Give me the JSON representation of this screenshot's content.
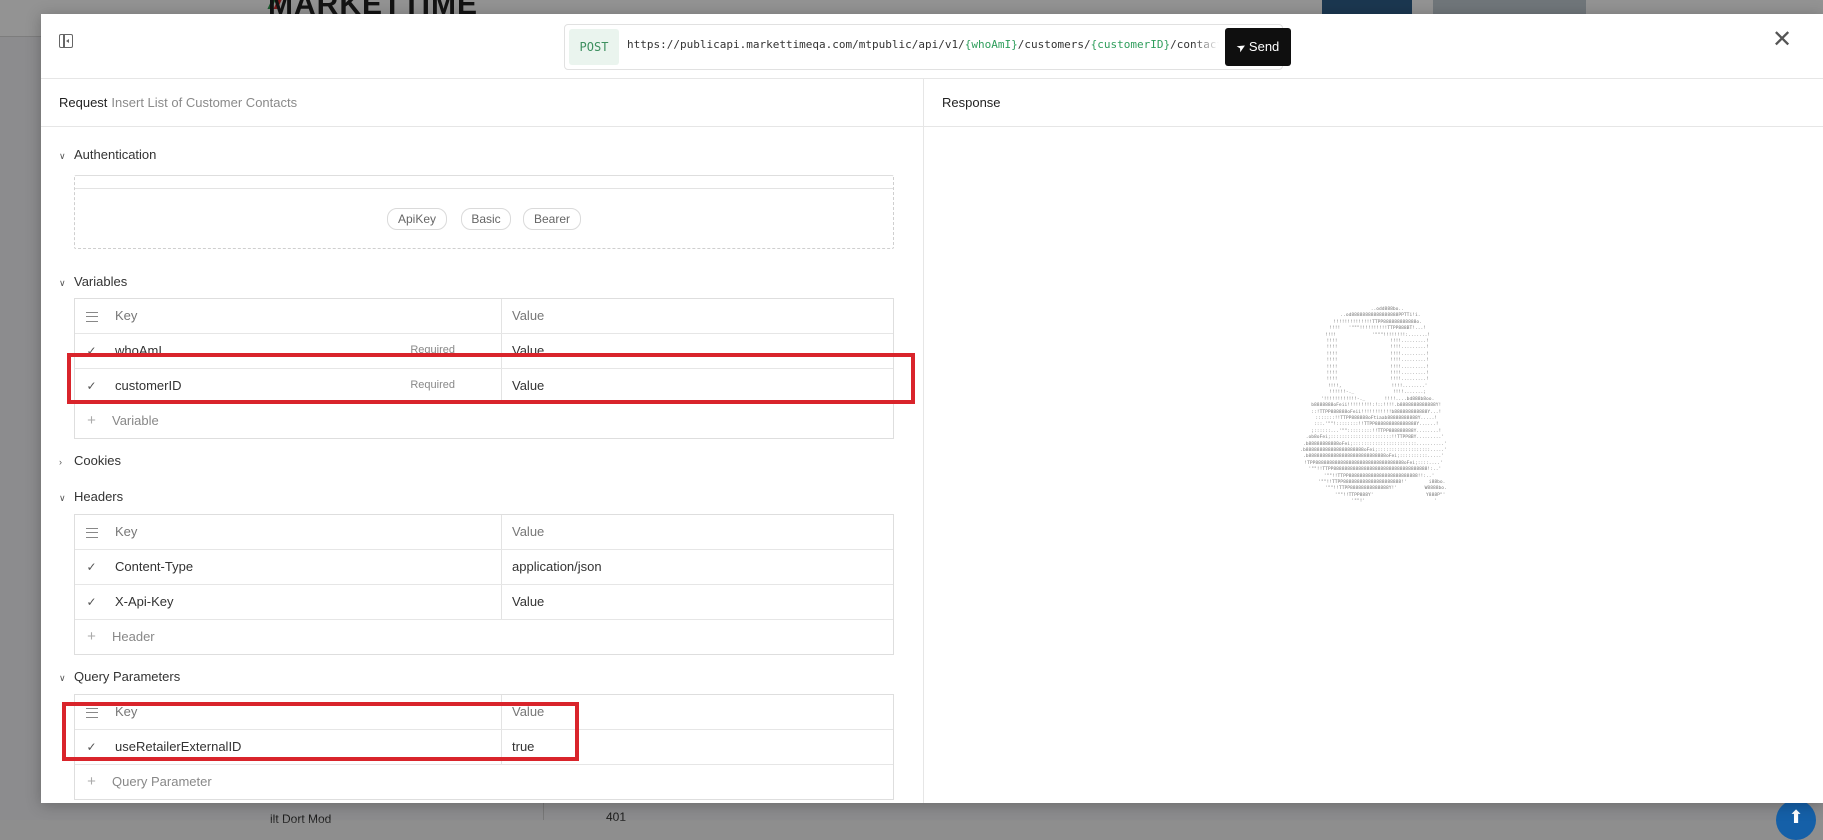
{
  "background": {
    "logo_text": "MARKETTIME",
    "bottom_text": "ilt Dort Mod",
    "bottom_number": "401",
    "scroll_top_icon": "arrow-up-icon"
  },
  "modal": {
    "url_bar": {
      "method": "POST",
      "url_prefix": "https://publicapi.markettimeqa.com/mtpublic/api/v1/",
      "var1": "{whoAmI}",
      "mid": "/customers/",
      "var2": "{customerID}",
      "suffix": "/contacts",
      "send_label": "Send"
    },
    "request": {
      "title": "Request",
      "subtitle": "Insert List of Customer Contacts",
      "authentication": {
        "label": "Authentication",
        "options": [
          "ApiKey",
          "Basic",
          "Bearer"
        ]
      },
      "variables": {
        "label": "Variables",
        "header_key": "Key",
        "header_value": "Value",
        "rows": [
          {
            "key": "whoAmI",
            "required": "Required",
            "value": "Value"
          },
          {
            "key": "customerID",
            "required": "Required",
            "value": "Value"
          }
        ],
        "add_label": "Variable"
      },
      "cookies": {
        "label": "Cookies"
      },
      "headers": {
        "label": "Headers",
        "header_key": "Key",
        "header_value": "Value",
        "rows": [
          {
            "key": "Content-Type",
            "value": "application/json"
          },
          {
            "key": "X-Api-Key",
            "value": "Value"
          }
        ],
        "add_label": "Header"
      },
      "query_parameters": {
        "label": "Query Parameters",
        "header_key": "Key",
        "header_value": "Value",
        "rows": [
          {
            "key": "useRetailerExternalID",
            "value": "true"
          }
        ],
        "add_label": "Query Parameter"
      }
    },
    "response": {
      "title": "Response",
      "art": "          ..odd888bo..\n     ..od88888888888888888PPTTi!i.\n   !!!!!!!!!!!!!!TTPP888888888888o.\n   !!!!   '\"\"\"!!!!!!!!!!TTPP888BT!...!\n   !!!!             '\"\"\"!!!!!!!!:.......!\n   !!!!                   !!!!.........!\n   !!!!                   !!!!.........!\n   !!!!                   !!!!.........!\n   !!!!                   !!!!.........!\n   !!!!                   !!!!.........!\n   !!!!                   !!!!.........!\n   !!!!                   !!!!.........!\n   !!!!,                  !!!!........'\n   !!!!!!-._              !!!!.......;\n   '!!!!!!!!!!!!-._       !!!!....bd888b8oo.\n  b8888888oFeii!!!!!!!!!:!::!!!!.b8888888888888Y!\n  ::!TTPP888888oFeii!!!!!!!!!!!b888888888888Y...!\n  :::::::!!TTPP888888oFtiaab88888888888Y.....!\n  :::.'\"\"!::::::::!!TTPP888888888888888Y......!\n  ;::::::...'\"\":::::::::!!TTPP888888888Y........!\n .ob8oFei;::::::::::::::::::::::!!TTPP8BY.........'\n .b88888888888oFei;:::::::::::::::::::::::..........'\n.b888888888888888888888oFei;:::::::::::::::::::.....'\n.b8888888888888888888888888888oFei;::::::::::.....'\n!TPP88888888888888888888888888888888oFei;::::....'\n '\"\"!!TTPP8888888888888888888888888888888888!:..'\n    '\"\"!!TTPP8888888888888888888888888!!:..'\n      '\"\"!!TTPP888888888888888888888!'        i88bo.\n         '\"\"!!TTPP88888888888888Y!'          W8888bo.\n            '\"\"!!TTPP888Y'                   Y888P\"'\n               '\"\"!'                         '"
    }
  }
}
